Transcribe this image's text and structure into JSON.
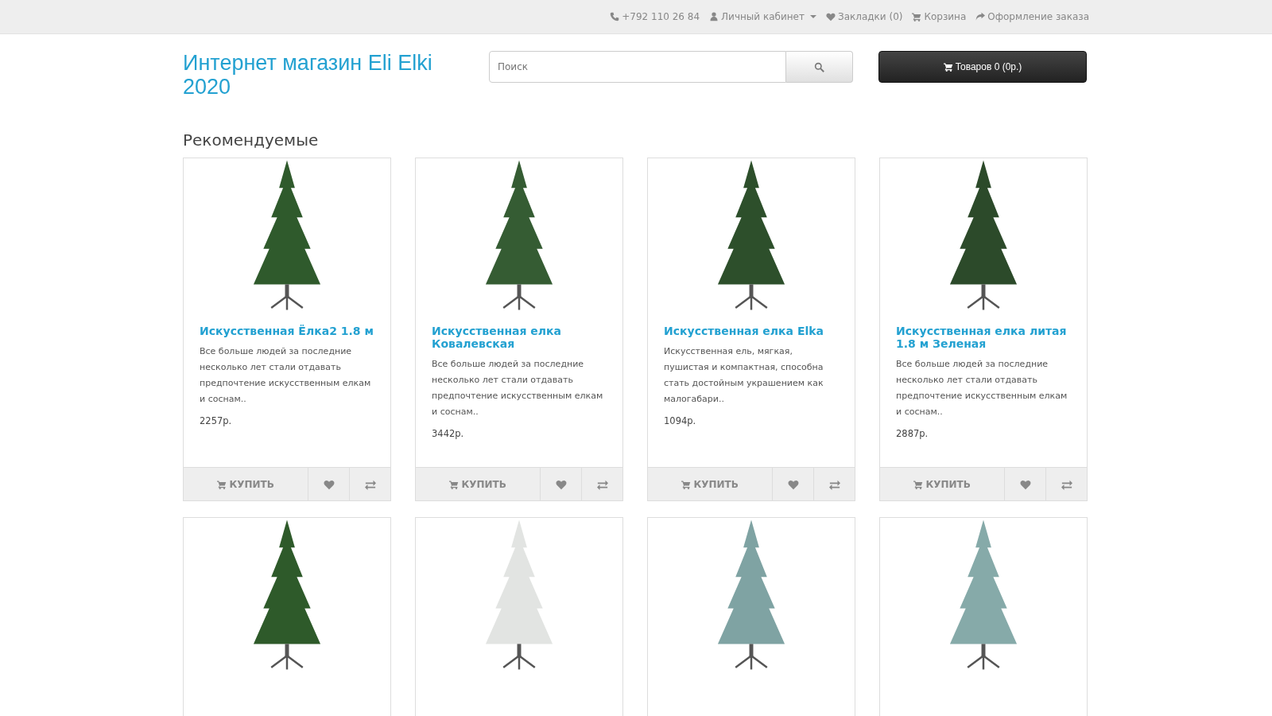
{
  "top_bar": {
    "phone": "+792 110 26 84",
    "links": [
      {
        "kind": "account",
        "label": "Личный кабинет",
        "dropdown": true
      },
      {
        "kind": "wishlist",
        "label": "Закладки (0)",
        "dropdown": false
      },
      {
        "kind": "cart",
        "label": "Корзина",
        "dropdown": false
      },
      {
        "kind": "checkout",
        "label": "Оформление заказа",
        "dropdown": false
      }
    ]
  },
  "header": {
    "logo": "Интернет магазин Eli Elki 2020",
    "search": {
      "placeholder": "Поиск"
    },
    "cart_button": "Товаров 0 (0р.)"
  },
  "section_title": "Рекомендуемые",
  "products": [
    {
      "name": "Искусственная Ёлка2 1.8 м",
      "description": "Все больше людей за последние несколько лет стали отдавать предпочтение искусственным елкам и соснам..",
      "price": "2257р.",
      "buy": "КУПИТЬ",
      "color": "#2f5a2c"
    },
    {
      "name": "Искусственная елка Ковалевская",
      "description": "Все больше людей за последние несколько лет стали отдавать предпочтение искусственным елкам и соснам..",
      "price": "3442р.",
      "buy": "КУПИТЬ",
      "color": "#355c33"
    },
    {
      "name": "Искусственная елка Elka",
      "description": "Искусственная ель, мягкая, пушистая и компактная, способна стать достойным украшением как малогабари..",
      "price": "1094р.",
      "buy": "КУПИТЬ",
      "color": "#2d4f2b"
    },
    {
      "name": "Искусственная елка литая 1.8 м Зеленая",
      "description": "Все больше людей за последние несколько лет стали отдавать предпочтение искусственным елкам и соснам..",
      "price": "2887р.",
      "buy": "КУПИТЬ",
      "color": "#2c4a2a"
    },
    {
      "color": "#2e5a2a"
    },
    {
      "color": "#e2e4e2"
    },
    {
      "color": "#7fa3a3"
    },
    {
      "color": "#86aaa9"
    }
  ]
}
